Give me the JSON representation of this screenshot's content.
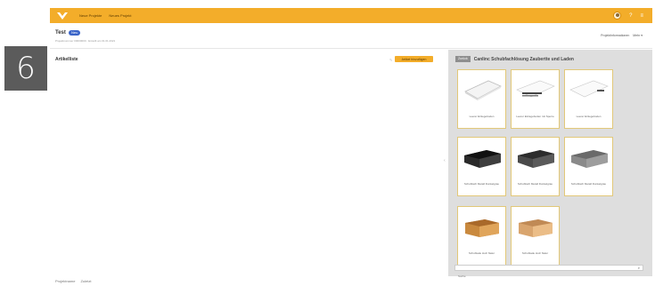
{
  "step": {
    "number": "6"
  },
  "topbar": {
    "nav": [
      "Neue Projekte",
      "Neues Projekt"
    ],
    "logo_color": "#ffffff",
    "bar_color": "#f3ad2a"
  },
  "header": {
    "title": "Test",
    "pill": "Neu",
    "subtitle": "Projektnummer 00000000 · Erstellt am 01.01.2021",
    "links": [
      "Projektinformationen",
      "Mehr ▾"
    ]
  },
  "left": {
    "panel_title": "Artikelliste",
    "edit_mark": "✎",
    "add_button": "Artikel hinzufügen",
    "collapse_icon": "‹"
  },
  "right": {
    "back_button": "Zurück",
    "category_title": "Canlinc Schubfachlösung Zaubertte und Laden",
    "tiles": [
      {
        "label": "Leerer Einlegeboden",
        "icon": "board"
      },
      {
        "label": "Leerer Einlegeboden mit Sperre",
        "icon": "board-white"
      },
      {
        "label": "Leerer Einlegeboden",
        "icon": "board-white"
      },
      {
        "label": "Schubfach Metall Dunkelgrau",
        "icon": "drawer-dark"
      },
      {
        "label": "Schubfach Metall Dunkelgrau",
        "icon": "drawer-dark"
      },
      {
        "label": "Schubfach Metall Dunkelgrau",
        "icon": "drawer-grey"
      },
      {
        "label": "Schublade Holz Natur",
        "icon": "wood-box"
      },
      {
        "label": "Schublade Holz Natur",
        "icon": "wood-box-light"
      }
    ],
    "search_placeholder": "Suche"
  },
  "footer": {
    "links": [
      "Projektname",
      "Zuletzt"
    ]
  }
}
